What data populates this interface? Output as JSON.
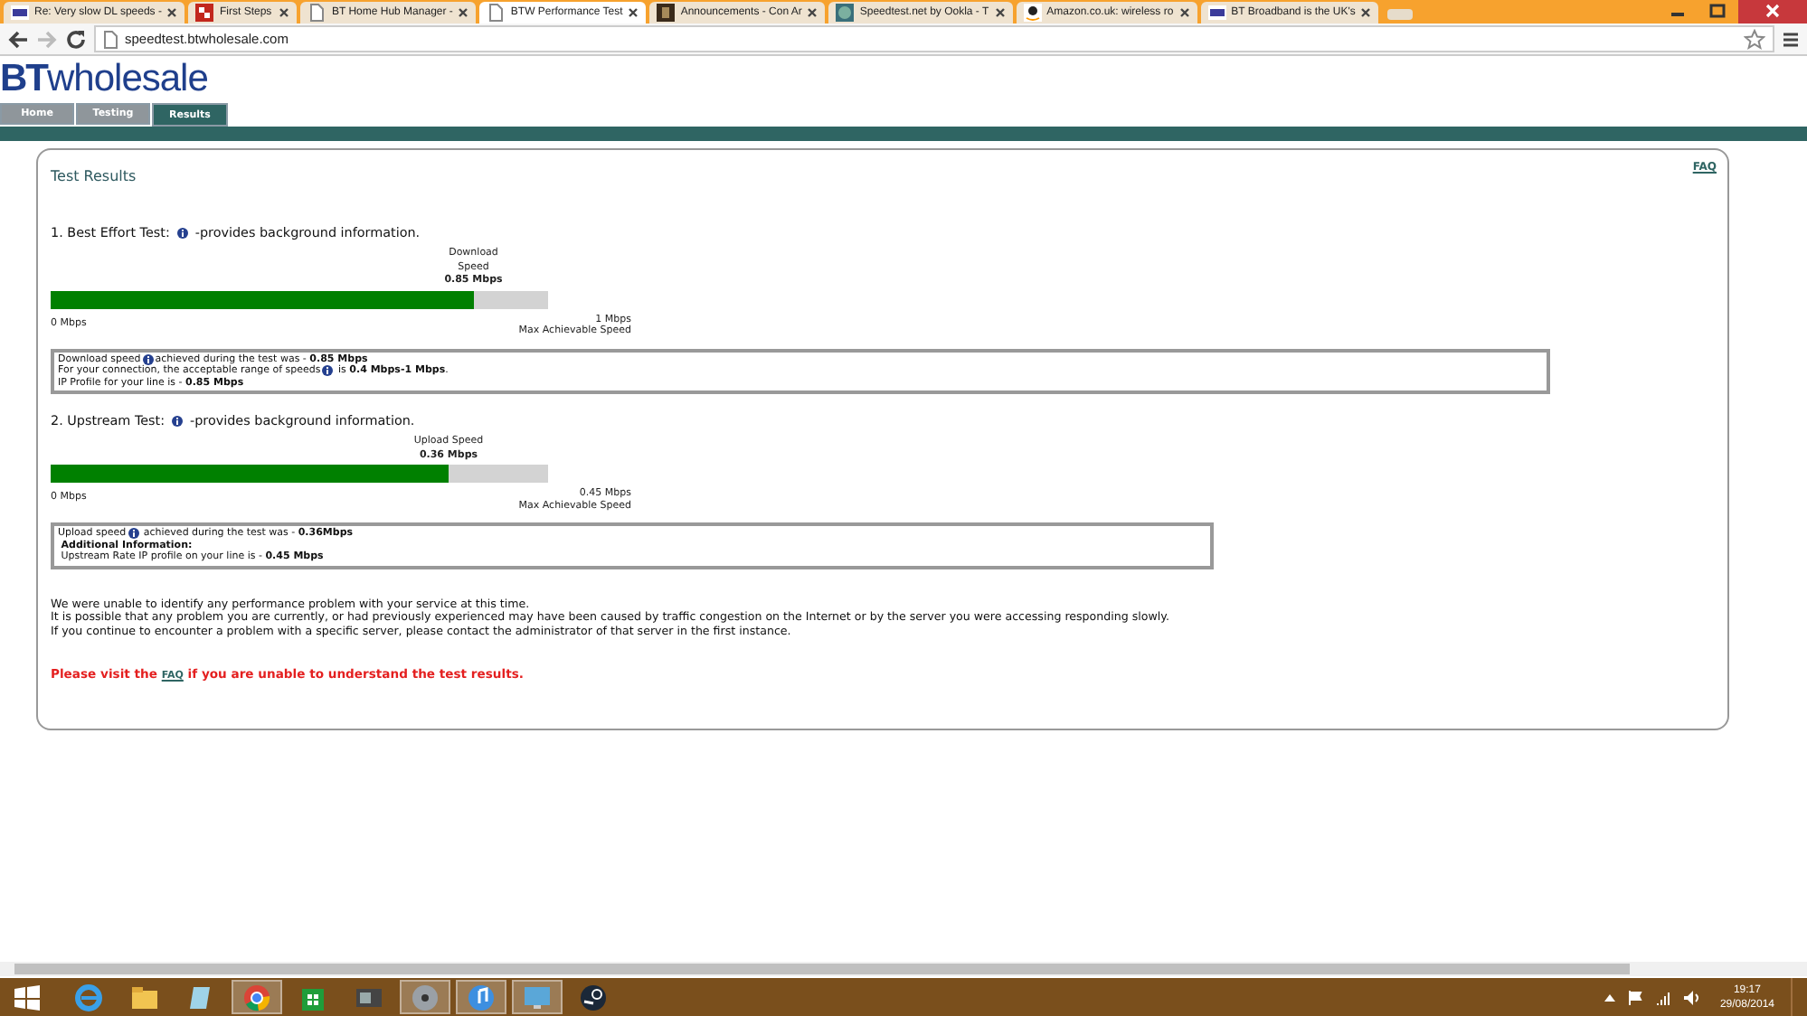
{
  "browser": {
    "tabs": [
      {
        "title": "Re: Very slow DL speeds -",
        "kind": "bt",
        "selected": false
      },
      {
        "title": "First Steps",
        "kind": "grid",
        "selected": false
      },
      {
        "title": "BT Home Hub Manager -",
        "kind": "page",
        "selected": false
      },
      {
        "title": "BTW Performance Test",
        "kind": "page",
        "selected": true
      },
      {
        "title": "Announcements - Con Ar",
        "kind": "dark",
        "selected": false
      },
      {
        "title": "Speedtest.net by Ookla - T",
        "kind": "globe",
        "selected": false
      },
      {
        "title": "Amazon.co.uk: wireless ro",
        "kind": "amazon",
        "selected": false
      },
      {
        "title": "BT Broadband is the UK's",
        "kind": "bt",
        "selected": false
      }
    ],
    "url": "speedtest.btwholesale.com"
  },
  "site": {
    "logo": {
      "brand": "BT",
      "name": "wholesale"
    },
    "nav": [
      {
        "label": "Home",
        "selected": false
      },
      {
        "label": "Testing",
        "selected": false
      },
      {
        "label": "Results",
        "selected": true
      }
    ]
  },
  "results": {
    "title": "Test Results",
    "faq": "FAQ",
    "tests": [
      {
        "number": "1. Best Effort Test:",
        "info_text": "-provides background information.",
        "gauge": {
          "label": [
            "Download",
            "Speed"
          ],
          "value": "0.85 Mbps",
          "level": 0.85,
          "min": "0 Mbps",
          "max": "1 Mbps",
          "max_label": "Max Achievable Speed"
        },
        "details": [
          [
            {
              "kind": "text",
              "text": "Download speed"
            },
            {
              "kind": "info"
            },
            {
              "kind": "text",
              "text": "achieved during the test was - **0.85 Mbps**"
            }
          ],
          [
            {
              "kind": "text",
              "text": "For your connection, the acceptable range of speeds"
            },
            {
              "kind": "info"
            },
            {
              "kind": "text",
              "text": " is **0.4 Mbps-1 Mbps**."
            }
          ],
          [
            {
              "kind": "text",
              "text": "IP Profile for your line is - **0.85 Mbps**"
            }
          ]
        ],
        "wide": true
      },
      {
        "number": "2. Upstream Test:",
        "info_text": "-provides background information.",
        "gauge": {
          "label": [
            "Upload Speed"
          ],
          "value": "0.36 Mbps",
          "level": 0.8,
          "min": "0 Mbps",
          "max": "0.45 Mbps",
          "max_label": "Max Achievable Speed"
        },
        "details": [
          [
            {
              "kind": "text",
              "text": "Upload speed"
            },
            {
              "kind": "info"
            },
            {
              "kind": "text",
              "text": " achieved during the test was - **0.36Mbps**"
            }
          ],
          [
            {
              "kind": "text",
              "text": " **Additional Information:**"
            }
          ],
          [
            {
              "kind": "text",
              "text": " Upstream Rate IP profile on your line is - **0.45 Mbps**"
            }
          ]
        ],
        "wide": false
      }
    ],
    "messages": [
      "We were unable to identify any performance problem with your service at this time.",
      "It is possible that any problem you are currently, or had previously experienced may have been caused by traffic congestion on the Internet or by the server you were accessing responding slowly.",
      "If you continue to encounter a problem with a specific server, please contact the administrator of that server in the first instance."
    ],
    "notice": {
      "before": "Please visit the",
      "link": "FAQ",
      "after": "if you are unable to understand the test results."
    }
  },
  "taskbar": {
    "apps": [
      {
        "kind": "ie",
        "active": false
      },
      {
        "kind": "folder",
        "active": false
      },
      {
        "kind": "notepad",
        "active": false
      },
      {
        "kind": "chrome",
        "active": true
      },
      {
        "kind": "store",
        "active": false
      },
      {
        "kind": "media",
        "active": false
      },
      {
        "kind": "disc",
        "active": true
      },
      {
        "kind": "itunes",
        "active": true
      },
      {
        "kind": "monitor",
        "active": true
      },
      {
        "kind": "steam",
        "active": false
      }
    ],
    "time": "19:17",
    "date": "29/08/2014"
  }
}
